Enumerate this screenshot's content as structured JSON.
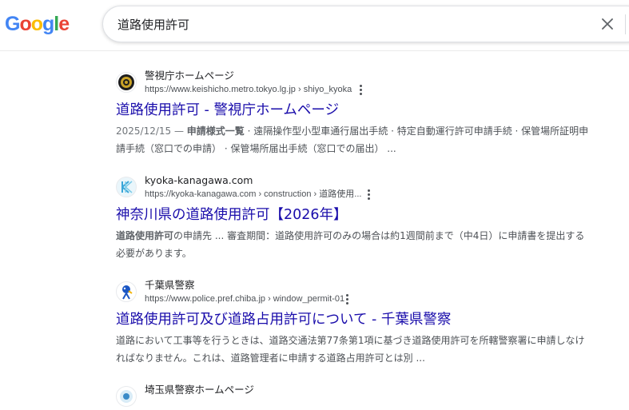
{
  "search": {
    "query": "道路使用許可"
  },
  "logo": {
    "letters": [
      "G",
      "o",
      "o",
      "g",
      "l",
      "e"
    ],
    "colors": [
      "#4285F4",
      "#EA4335",
      "#FBBC05",
      "#4285F4",
      "#34A853",
      "#EA4335"
    ]
  },
  "results": [
    {
      "site_name": "警視庁ホームページ",
      "url": "https://www.keishicho.metro.tokyo.lg.jp › shiyo_kyoka",
      "title": "道路使用許可 - 警視庁ホームページ",
      "date": "2025/12/15 — ",
      "snippet_bold": "申請様式一覧",
      "snippet": " · 遠隔操作型小型車通行届出手続 · 特定自動運行許可申請手続 · 保管場所証明申請手続（窓口での申請） · 保管場所届出手続（窓口での届出） ..."
    },
    {
      "site_name": "kyoka-kanagawa.com",
      "url": "https://kyoka-kanagawa.com › construction › 道路使用...",
      "title": "神奈川県の道路使用許可【2026年】",
      "date": "",
      "snippet_bold": "道路使用許可",
      "snippet": "の申請先 ... 審査期間：道路使用許可のみの場合は約1週間前まで（中4日）に申請書を提出する必要があります。"
    },
    {
      "site_name": "千葉県警察",
      "url": "https://www.police.pref.chiba.jp › window_permit-01",
      "title": "道路使用許可及び道路占用許可について - 千葉県警察",
      "date": "",
      "snippet_bold": "",
      "snippet": "道路において工事等を行うときは、道路交通法第77条第1項に基づき道路使用許可を所轄警察署に申請しなければなりません。これは、道路管理者に申請する道路占用許可とは別 ..."
    },
    {
      "site_name": "埼玉県警察ホームページ",
      "url": "",
      "title": "",
      "date": "",
      "snippet_bold": "",
      "snippet": ""
    }
  ]
}
